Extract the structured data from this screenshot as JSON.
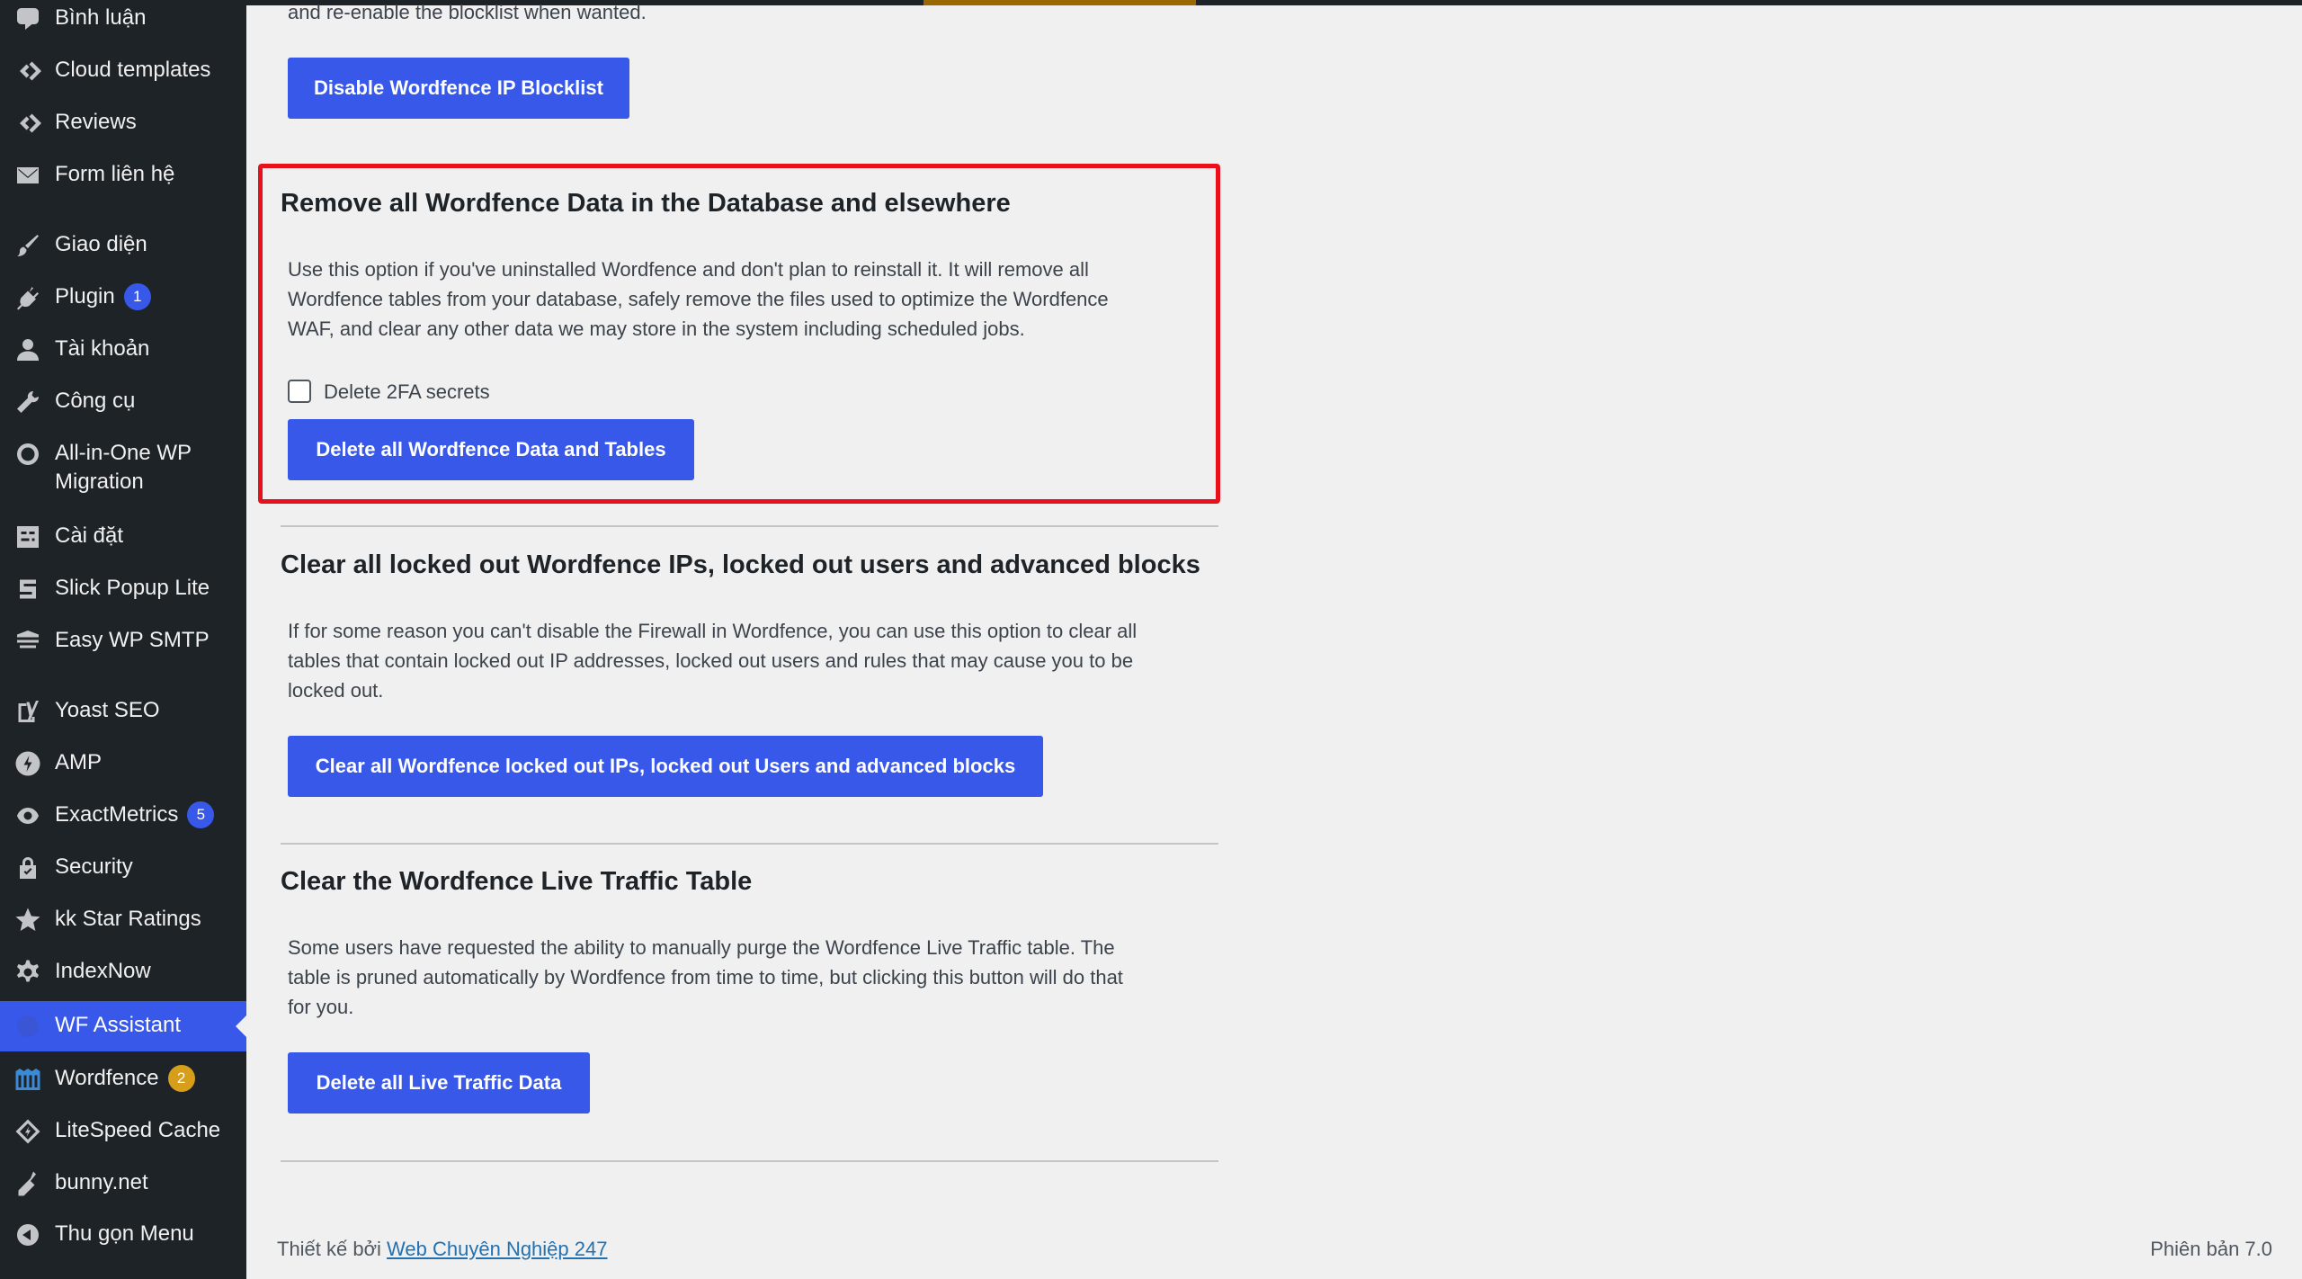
{
  "sidebar": {
    "items": [
      {
        "label": "Bình luận",
        "icon": "comment-icon"
      },
      {
        "label": "Cloud templates",
        "icon": "elementor-icon"
      },
      {
        "label": "Reviews",
        "icon": "elementor-icon"
      },
      {
        "label": "Form liên hệ",
        "icon": "mail-icon"
      },
      {
        "label": "Giao diện",
        "icon": "brush-icon"
      },
      {
        "label": "Plugin",
        "icon": "plugin-icon",
        "badge": "1"
      },
      {
        "label": "Tài khoản",
        "icon": "user-icon"
      },
      {
        "label": "Công cụ",
        "icon": "wrench-icon"
      },
      {
        "label": "All-in-One WP Migration",
        "icon": "migration-icon"
      },
      {
        "label": "Cài đặt",
        "icon": "settings-icon"
      },
      {
        "label": "Slick Popup Lite",
        "icon": "popup-icon"
      },
      {
        "label": "Easy WP SMTP",
        "icon": "smtp-icon"
      },
      {
        "label": "Yoast SEO",
        "icon": "yoast-icon"
      },
      {
        "label": "AMP",
        "icon": "amp-icon"
      },
      {
        "label": "ExactMetrics",
        "icon": "metrics-icon",
        "badge": "5"
      },
      {
        "label": "Security",
        "icon": "lock-icon"
      },
      {
        "label": "kk Star Ratings",
        "icon": "star-icon"
      },
      {
        "label": "IndexNow",
        "icon": "gear-icon"
      },
      {
        "label": "WF Assistant",
        "icon": "wf-assistant-icon"
      },
      {
        "label": "Wordfence",
        "icon": "wordfence-icon",
        "badge": "2"
      },
      {
        "label": "LiteSpeed Cache",
        "icon": "litespeed-icon"
      },
      {
        "label": "bunny.net",
        "icon": "bunny-icon"
      },
      {
        "label": "Thu gọn Menu",
        "icon": "collapse-icon"
      }
    ],
    "badge_color_blue": "#3858e9",
    "badge_color_orange": "#d69e1a"
  },
  "main": {
    "top_text": "and re-enable the blocklist when wanted.",
    "disable_button": "Disable Wordfence IP Blocklist",
    "section1": {
      "title": "Remove all Wordfence Data in the Database and elsewhere",
      "desc_lines": [
        "Use this option if you've uninstalled Wordfence and don't plan to reinstall it. It will remove all",
        "Wordfence tables from your database, safely remove the files used to optimize the Wordfence",
        "WAF, and clear any other data we may store in the system including scheduled jobs."
      ],
      "checkbox_label": "Delete 2FA secrets",
      "button": "Delete all Wordfence Data and Tables"
    },
    "section2": {
      "title": "Clear all locked out Wordfence IPs, locked out users and advanced blocks",
      "desc_lines": [
        "If for some reason you can't disable the Firewall in Wordfence, you can use this option to clear all",
        "tables that contain locked out IP addresses, locked out users and rules that may cause you to be",
        "locked out."
      ],
      "button": "Clear all Wordfence locked out IPs, locked out Users and advanced blocks"
    },
    "section3": {
      "title": "Clear the Wordfence Live Traffic Table",
      "desc_lines": [
        "Some users have requested the ability to manually purge the Wordfence Live Traffic table. The",
        "table is pruned automatically by Wordfence from time to time, but clicking this button will do that",
        "for you."
      ],
      "button": "Delete all Live Traffic Data"
    }
  },
  "footer": {
    "prefix": "Thiết kế bởi",
    "link": "Web Chuyên Nghiệp 247",
    "version": "Phiên bản 7.0"
  },
  "colors": {
    "accent": "#3858e9",
    "highlight": "#e8111b",
    "sidebar_bg": "#1d2327"
  }
}
